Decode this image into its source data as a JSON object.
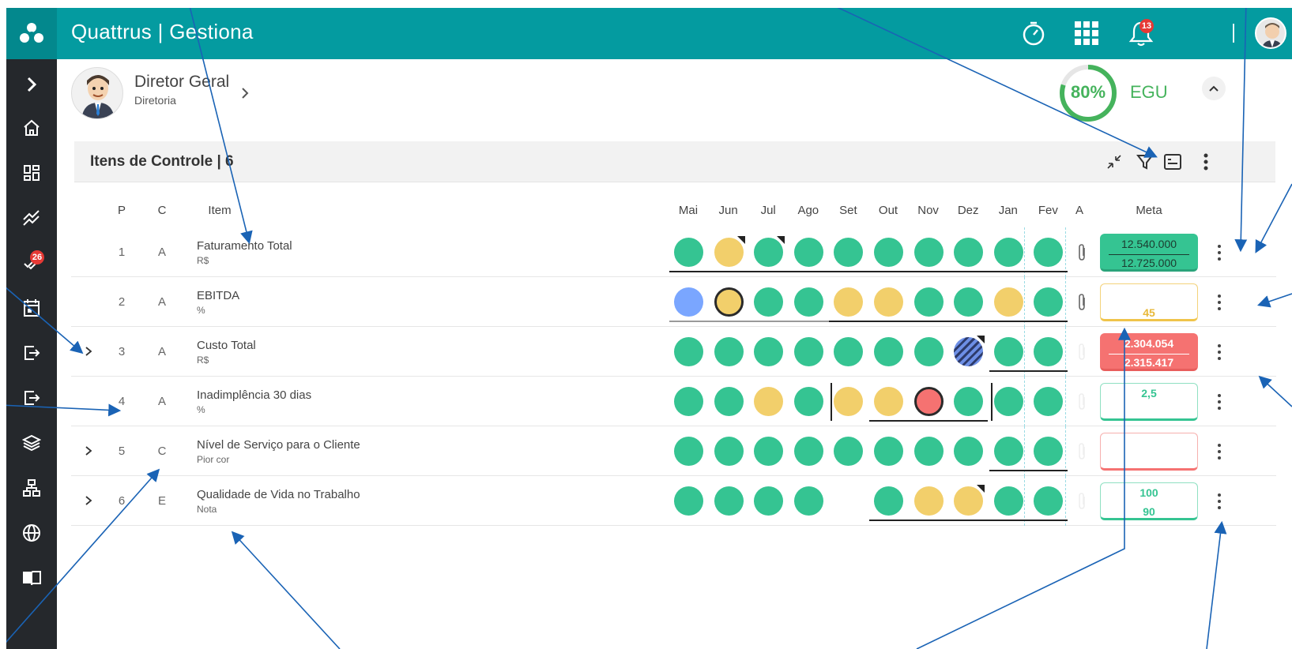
{
  "app": {
    "title": "Quattrus | Gestiona"
  },
  "topbar": {
    "notifications_count": "13"
  },
  "sidebar": {
    "items": [
      {
        "icon": "chevron-right-icon"
      },
      {
        "icon": "home-icon"
      },
      {
        "icon": "dashboard-icon"
      },
      {
        "icon": "trend-icon"
      },
      {
        "icon": "tasks-check-icon",
        "badge": "26"
      },
      {
        "icon": "calendar-icon"
      },
      {
        "icon": "login-icon"
      },
      {
        "icon": "logout-icon"
      },
      {
        "icon": "layers-icon"
      },
      {
        "icon": "org-chart-icon"
      },
      {
        "icon": "globe-icon"
      },
      {
        "icon": "book-icon"
      }
    ]
  },
  "profile": {
    "name": "Diretor Geral",
    "department": "Diretoria"
  },
  "egu": {
    "percent_label": "80%",
    "value": 0.8,
    "label": "EGU",
    "color": "#45b35c"
  },
  "section": {
    "title": "Itens de Controle | 6"
  },
  "table": {
    "headers": {
      "p": "P",
      "c": "C",
      "item": "Item",
      "a": "A",
      "meta": "Meta"
    },
    "months": [
      "Mai",
      "Jun",
      "Jul",
      "Ago",
      "Set",
      "Out",
      "Nov",
      "Dez",
      "Jan",
      "Fev"
    ],
    "rows": [
      {
        "p": "1",
        "c": "A",
        "name": "Faturamento Total",
        "unit": "R$",
        "expandable": false,
        "dots": [
          "g",
          "y",
          "g",
          "g",
          "g",
          "g",
          "g",
          "g",
          "g",
          "g"
        ],
        "meta": {
          "top": "12.540.000",
          "bottom": "12.725.000",
          "style": "filled-green"
        }
      },
      {
        "p": "2",
        "c": "A",
        "name": "EBITDA",
        "unit": "%",
        "expandable": false,
        "dots": [
          "b",
          "y",
          "g",
          "g",
          "y",
          "y",
          "g",
          "g",
          "y",
          "g"
        ],
        "meta": {
          "top": "",
          "bottom": "45",
          "style": "outline-yellow"
        }
      },
      {
        "p": "3",
        "c": "A",
        "name": "Custo Total",
        "unit": "R$",
        "expandable": true,
        "dots": [
          "g",
          "g",
          "g",
          "g",
          "g",
          "g",
          "g",
          "hatch",
          "g",
          "g"
        ],
        "meta": {
          "top": "2.304.054",
          "bottom": "2.315.417",
          "style": "filled-red"
        }
      },
      {
        "p": "4",
        "c": "A",
        "name": "Inadimplência 30 dias",
        "unit": "%",
        "expandable": false,
        "dots": [
          "g",
          "g",
          "y",
          "g",
          "y",
          "y",
          "r",
          "g",
          "g",
          "g"
        ],
        "meta": {
          "top": "2,5",
          "bottom": "",
          "style": "outline-green"
        }
      },
      {
        "p": "5",
        "c": "C",
        "name": "Nível de Serviço para o Cliente",
        "unit": "Pior cor",
        "expandable": true,
        "dots": [
          "g",
          "g",
          "g",
          "g",
          "g",
          "g",
          "g",
          "g",
          "g",
          "g"
        ],
        "meta": {
          "top": "",
          "bottom": "",
          "style": "outline-red"
        }
      },
      {
        "p": "6",
        "c": "E",
        "name": "Qualidade de Vida no Trabalho",
        "unit": "Nota",
        "expandable": true,
        "dots": [
          "g",
          "g",
          "g",
          "g",
          "",
          "g",
          "y",
          "y",
          "g",
          "g"
        ],
        "meta": {
          "top": "100",
          "bottom": "90",
          "style": "outline-green"
        }
      }
    ]
  },
  "colors": {
    "primary": "#049ba0",
    "green": "#35c492",
    "yellow": "#f2cf6b",
    "red": "#f57271",
    "blue": "#7aa6ff",
    "sidebar": "#25282c"
  }
}
